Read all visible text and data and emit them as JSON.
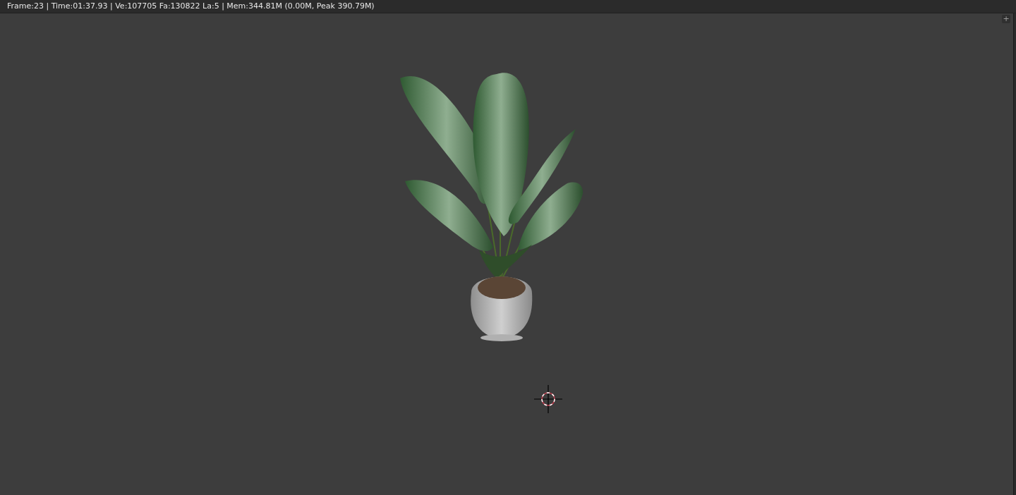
{
  "header": {
    "render_info": "Frame:23 | Time:01:37.93 | Ve:107705 Fa:130822 La:5 | Mem:344.81M (0.00M, Peak 390.79M)"
  },
  "viewport": {
    "add_button": "+"
  }
}
